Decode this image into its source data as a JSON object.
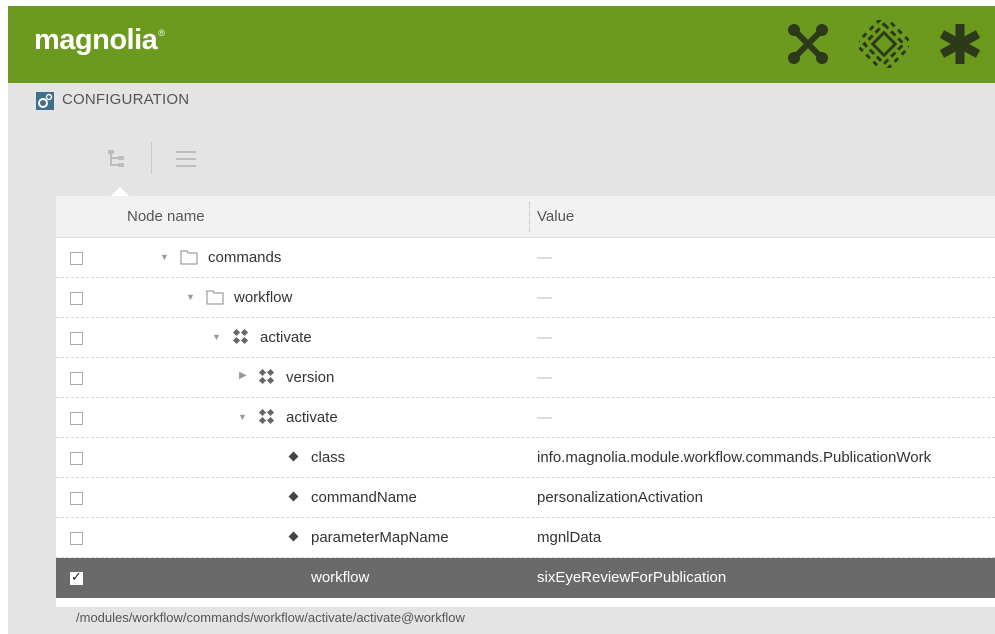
{
  "header": {
    "logo": "magnolia",
    "logo_mark": "®",
    "icons": [
      "x-shaped-apps-icon",
      "pulse-icon",
      "asterisk-favorites-icon"
    ],
    "background": "#6b9a1f"
  },
  "app": {
    "title": "CONFIGURATION",
    "title_icon": "gear-config-icon"
  },
  "view_switch": {
    "tree_view": "tree-view-icon",
    "list_view": "list-view-icon"
  },
  "grid": {
    "columns": [
      "Node name",
      "Value"
    ],
    "rows": [
      {
        "name": "commands",
        "value": "—",
        "type": "folder",
        "expander": "open",
        "depth": 0,
        "checked": false
      },
      {
        "name": "workflow",
        "value": "—",
        "type": "folder",
        "expander": "open",
        "depth": 1,
        "checked": false
      },
      {
        "name": "activate",
        "value": "—",
        "type": "content-node",
        "expander": "open",
        "depth": 2,
        "checked": false
      },
      {
        "name": "version",
        "value": "—",
        "type": "content-node",
        "expander": "closed",
        "depth": 3,
        "checked": false
      },
      {
        "name": "activate",
        "value": "—",
        "type": "content-node",
        "expander": "open",
        "depth": 3,
        "checked": false
      },
      {
        "name": "class",
        "value": "info.magnolia.module.workflow.commands.PublicationWork",
        "type": "property",
        "depth": 4,
        "checked": false
      },
      {
        "name": "commandName",
        "value": "personalizationActivation",
        "type": "property",
        "depth": 4,
        "checked": false
      },
      {
        "name": "parameterMapName",
        "value": "mgnlData",
        "type": "property",
        "depth": 4,
        "checked": false
      },
      {
        "name": "workflow",
        "value": "sixEyeReviewForPublication",
        "type": "property",
        "depth": 4,
        "checked": true,
        "selected": true
      }
    ]
  },
  "status": {
    "path": "/modules/workflow/commands/workflow/activate/activate@workflow"
  }
}
